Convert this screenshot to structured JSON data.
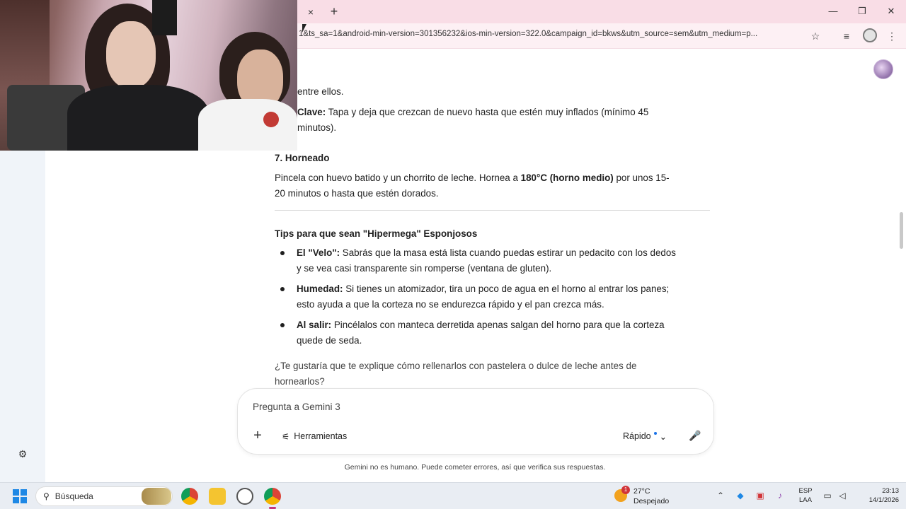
{
  "browser": {
    "tab_close_glyph": "×",
    "new_tab_glyph": "+",
    "url": "1&ts_sa=1&android-min-version=301356232&ios-min-version=322.0&campaign_id=bkws&utm_source=sem&utm_medium=p...",
    "window": {
      "minimize": "—",
      "maximize": "❐",
      "close": "✕"
    },
    "toolbar_icons": [
      "star-icon",
      "playlist-icon",
      "extension-icon",
      "menu-icon"
    ]
  },
  "chat": {
    "lines": {
      "fragment_1": "entre ellos.",
      "clave_label": "Clave:",
      "clave_text": " Tapa y deja que crezcan de nuevo hasta que estén muy inflados (mínimo 45",
      "clave_cont": "minutos).",
      "step7_heading": "7. Horneado",
      "step7_line1_a": "Pincela con huevo batido y un chorrito de leche. Hornea a ",
      "step7_line1_b": "180°C (horno medio)",
      "step7_line1_c": " por unos 15-",
      "step7_line2": "20 minutos o hasta que estén dorados.",
      "tips_heading": "Tips para que sean \"Hipermega\" Esponjosos"
    },
    "tips": [
      {
        "label": "El \"Velo\":",
        "line1": " Sabrás que la masa está lista cuando puedas estirar un pedacito con los dedos",
        "line2": "y se vea casi transparente sin romperse (ventana de gluten)."
      },
      {
        "label": "Humedad:",
        "line1": " Si tienes un atomizador, tira un poco de agua en el horno al entrar los panes;",
        "line2": "esto ayuda a que la corteza no se endurezca rápido y el pan crezca más."
      },
      {
        "label": "Al salir:",
        "line1": " Pincélalos con manteca derretida apenas salgan del horno para que la corteza",
        "line2": "quede de seda."
      }
    ],
    "followup_line1": "¿Te gustaría que te explique cómo rellenarlos con pastelera o dulce de leche antes de",
    "followup_line2": "hornearlos?"
  },
  "input": {
    "placeholder": "Pregunta a Gemini 3",
    "add_glyph": "+",
    "tools_label": "Herramientas",
    "mode_label": "Rápido",
    "mic_glyph": "🎤",
    "disclaimer": "Gemini no es humano. Puede cometer errores, así que verifica sus respuestas."
  },
  "taskbar": {
    "search_label": "Búsqueda",
    "weather_badge": "1",
    "weather_temp": "27°C",
    "weather_desc": "Despejado",
    "lang_line1": "ESP",
    "lang_line2": "LAA",
    "time": "23:13",
    "date": "14/1/2026"
  },
  "colors": {
    "tab_strip": "#f9dde6",
    "toolbar": "#fdf0f4",
    "accent": "#1a73e8",
    "taskbar": "#e9edf3"
  }
}
